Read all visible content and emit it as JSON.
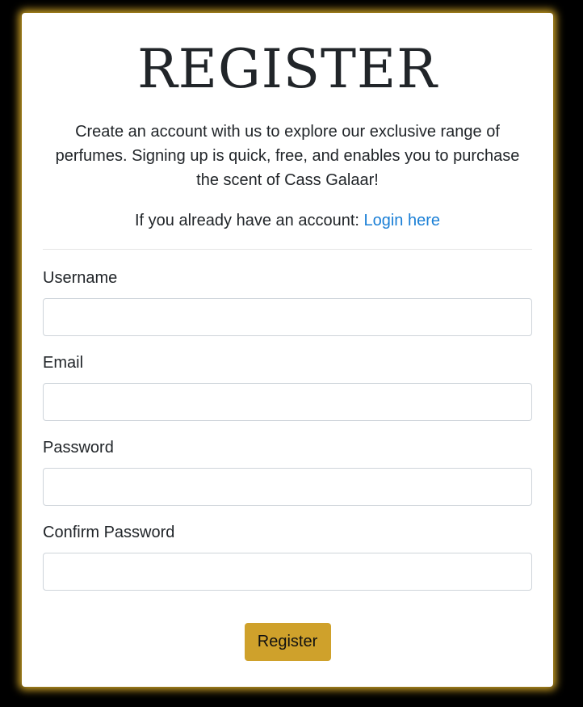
{
  "colors": {
    "page_background": "#000000",
    "card_glow": "#d4a626",
    "accent_button": "#cfa12b",
    "link": "#1a7fd6"
  },
  "header": {
    "title": "REGISTER"
  },
  "intro": {
    "text": "Create an account with us to explore our exclusive range of perfumes. Signing up is quick, free, and enables you to purchase the scent of Cass Galaar!"
  },
  "login_prompt": {
    "text": "If you already have an account: ",
    "link_label": "Login here"
  },
  "form": {
    "fields": [
      {
        "label": "Username",
        "value": "",
        "placeholder": ""
      },
      {
        "label": "Email",
        "value": "",
        "placeholder": ""
      },
      {
        "label": "Password",
        "value": "",
        "placeholder": ""
      },
      {
        "label": "Confirm Password",
        "value": "",
        "placeholder": ""
      }
    ],
    "submit_label": "Register"
  }
}
